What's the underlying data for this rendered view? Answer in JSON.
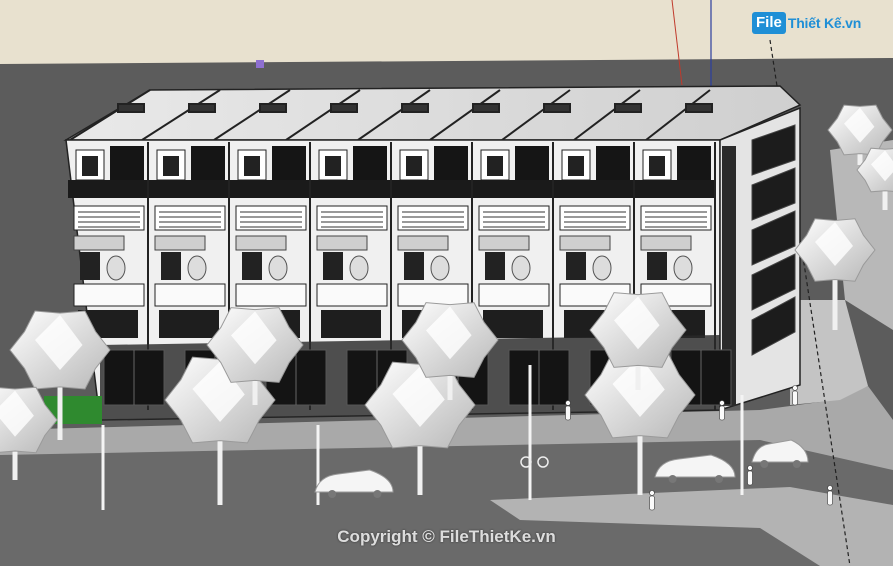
{
  "watermark": {
    "logo_box": "File",
    "logo_text": "Thiết Kế.vn",
    "copyright": "Copyright © FileThietKe.vn"
  },
  "colors": {
    "sky": "#e8e1cf",
    "ground": "#5b5b5b",
    "sidewalk": "#bdbdbd",
    "road_edge": "#9a9a9a",
    "facade": "#f2f2f2",
    "glass": "#1b1b1b",
    "tree": "#e6e6e6",
    "logo_blue": "#1f8fd6",
    "selection_marker": "#8e6fd0"
  },
  "scene": {
    "subject": "4-storey row townhouse block 3D model",
    "trees": 11,
    "cars": 3,
    "people": 6
  }
}
